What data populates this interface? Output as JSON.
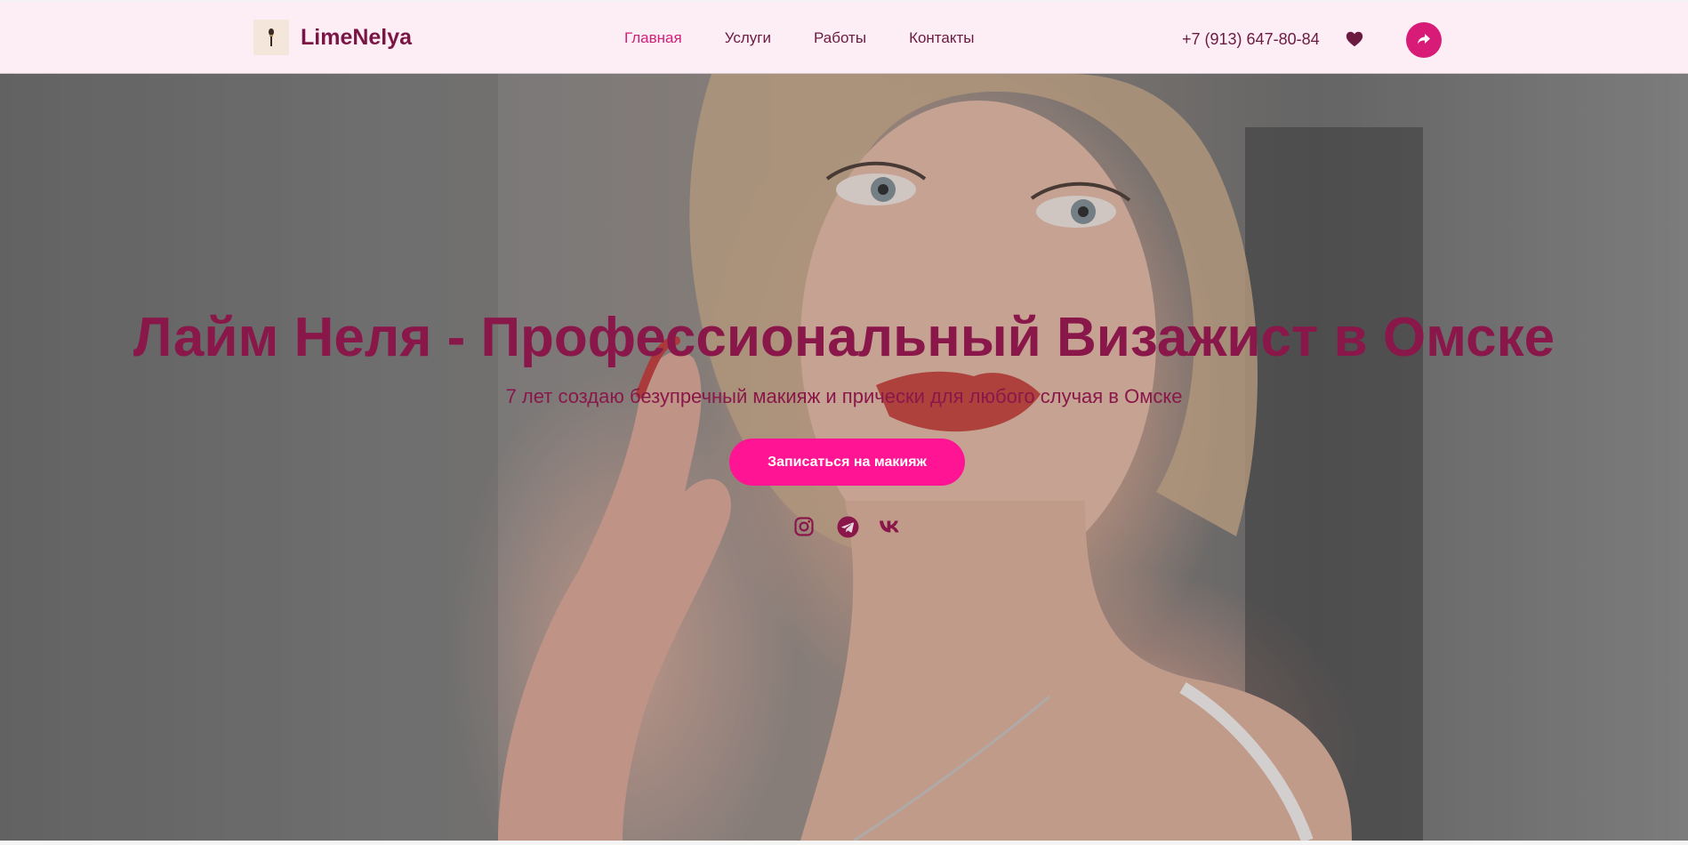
{
  "header": {
    "logo_text": "LimeNelya",
    "nav": [
      {
        "label": "Главная",
        "active": true
      },
      {
        "label": "Услуги",
        "active": false
      },
      {
        "label": "Работы",
        "active": false
      },
      {
        "label": "Контакты",
        "active": false
      }
    ],
    "phone": "+7 (913) 647-80-84",
    "icons": {
      "favorite": "heart-icon",
      "share": "share-icon",
      "logo": "makeup-brush-icon"
    }
  },
  "hero": {
    "title": "Лайм Неля - Профессиональный Визажист в Омске",
    "subtitle": "7 лет создаю безупречный макияж и прически для любого случая в Омске",
    "cta_label": "Записаться на макияж",
    "social": [
      "instagram-icon",
      "telegram-icon",
      "vk-icon"
    ]
  },
  "colors": {
    "header_bg": "#fdeef5",
    "brand": "#7a1645",
    "accent": "#d1207a",
    "cta": "#ff1493",
    "title": "#8a174a"
  }
}
